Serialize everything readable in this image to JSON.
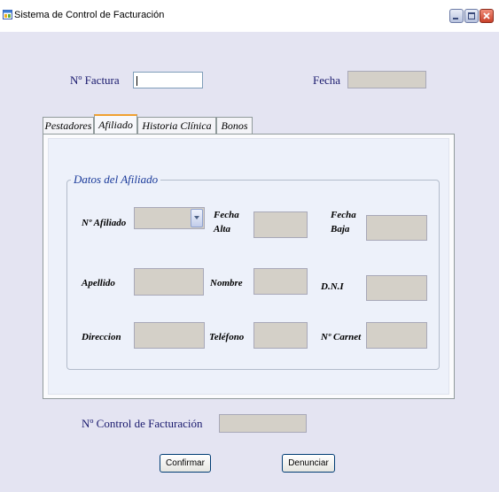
{
  "window": {
    "title": "Sistema de Control de Facturación",
    "accent": "#e4e4f2",
    "close_color": "#c9412a"
  },
  "header": {
    "factura_label": "Nº Factura",
    "factura_value": "",
    "fecha_label": "Fecha",
    "fecha_value": ""
  },
  "tabs": [
    {
      "label": "Pestadores",
      "active": false
    },
    {
      "label": "Afiliado",
      "active": true
    },
    {
      "label": "Historia Clínica",
      "active": false
    },
    {
      "label": "Bonos",
      "active": false
    }
  ],
  "group": {
    "legend": "Datos del Afiliado",
    "fields": {
      "nro_afiliado_label": "Nº Afiliado",
      "fecha_alta_label_1": "Fecha",
      "fecha_alta_label_2": "Alta",
      "fecha_baja_label_1": "Fecha",
      "fecha_baja_label_2": "Baja",
      "apellido_label": "Apellido",
      "nombre_label": "Nombre",
      "dni_label": "D.N.I",
      "direccion_label": "Direccion",
      "telefono_label": "Teléfono",
      "nro_carnet_label": "Nº Carnet"
    }
  },
  "footer": {
    "control_label": "Nº Control de Facturación",
    "control_value": "",
    "confirm_label": "Confirmar",
    "denounce_label": "Denunciar"
  },
  "icons": {
    "app": "app-window-icon",
    "minimize": "minimize-icon",
    "maximize": "maximize-icon",
    "close": "close-icon",
    "dropdown": "chevron-down-icon"
  }
}
